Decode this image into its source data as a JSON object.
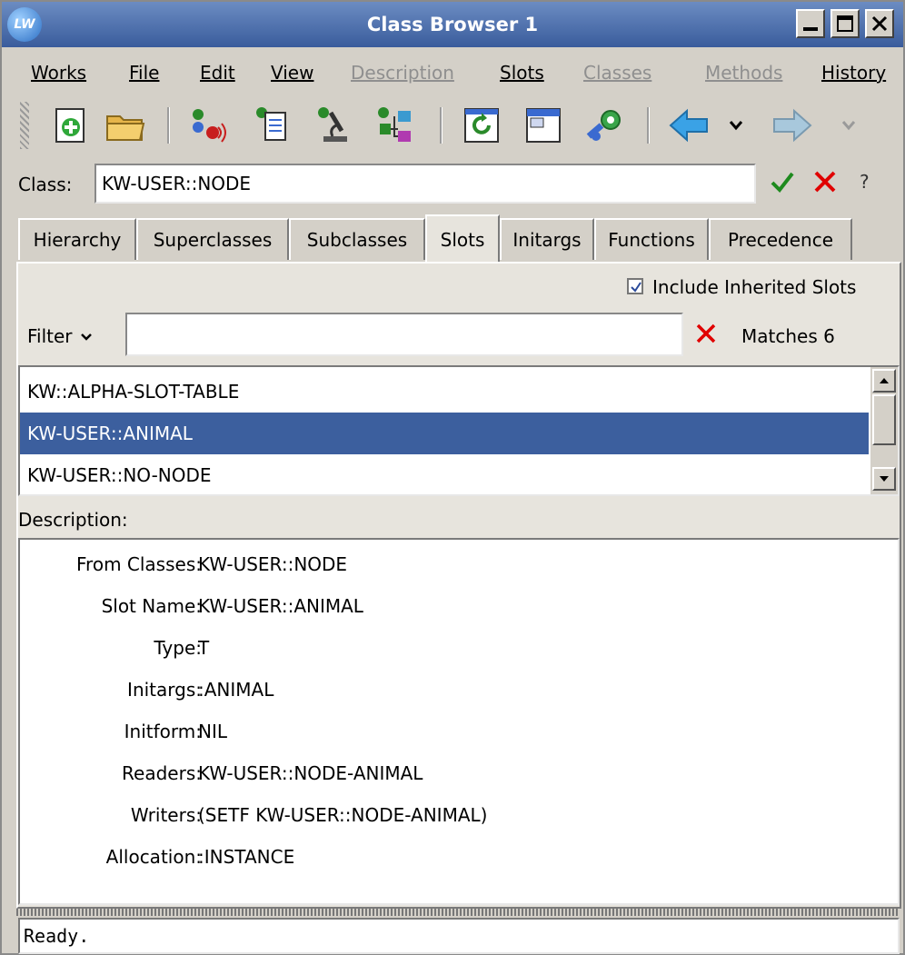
{
  "window": {
    "title": "Class Browser 1",
    "logo_text": "LW"
  },
  "menu": [
    {
      "label": "Works",
      "enabled": true
    },
    {
      "label": "File",
      "enabled": true
    },
    {
      "label": "Edit",
      "enabled": true
    },
    {
      "label": "View",
      "enabled": true
    },
    {
      "label": "Description",
      "enabled": false
    },
    {
      "label": "Slots",
      "enabled": true
    },
    {
      "label": "Classes",
      "enabled": false
    },
    {
      "label": "Methods",
      "enabled": false
    },
    {
      "label": "History",
      "enabled": true
    }
  ],
  "class_field": {
    "label": "Class:",
    "value": "KW-USER::NODE",
    "help": "?"
  },
  "tabs": [
    "Hierarchy",
    "Superclasses",
    "Subclasses",
    "Slots",
    "Initargs",
    "Functions",
    "Precedence"
  ],
  "active_tab": "Slots",
  "include_inherited": {
    "label": "Include Inherited Slots",
    "checked": true
  },
  "filter": {
    "button_label": "Filter",
    "value": "",
    "matches": "Matches 6"
  },
  "slots": [
    {
      "name": "KW::ALPHA-SLOT-TABLE",
      "selected": false
    },
    {
      "name": "KW-USER::ANIMAL",
      "selected": true
    },
    {
      "name": "KW-USER::NO-NODE",
      "selected": false
    }
  ],
  "description": {
    "label": "Description:",
    "rows": [
      {
        "key": "From Classes:",
        "value": "KW-USER::NODE"
      },
      {
        "key": "Slot Name:",
        "value": "KW-USER::ANIMAL"
      },
      {
        "key": "Type:",
        "value": "T"
      },
      {
        "key": "Initargs:",
        "value": ":ANIMAL"
      },
      {
        "key": "Initform:",
        "value": "NIL"
      },
      {
        "key": "Readers:",
        "value": "KW-USER::NODE-ANIMAL"
      },
      {
        "key": "Writers:",
        "value": "(SETF KW-USER::NODE-ANIMAL)"
      },
      {
        "key": "Allocation:",
        "value": ":INSTANCE"
      }
    ]
  },
  "status": "Ready.",
  "colors": {
    "title_bar": "#4a6aa8",
    "selection": "#3c5f9e",
    "ok_green": "#1e8a1e",
    "cancel_red": "#e00000"
  }
}
